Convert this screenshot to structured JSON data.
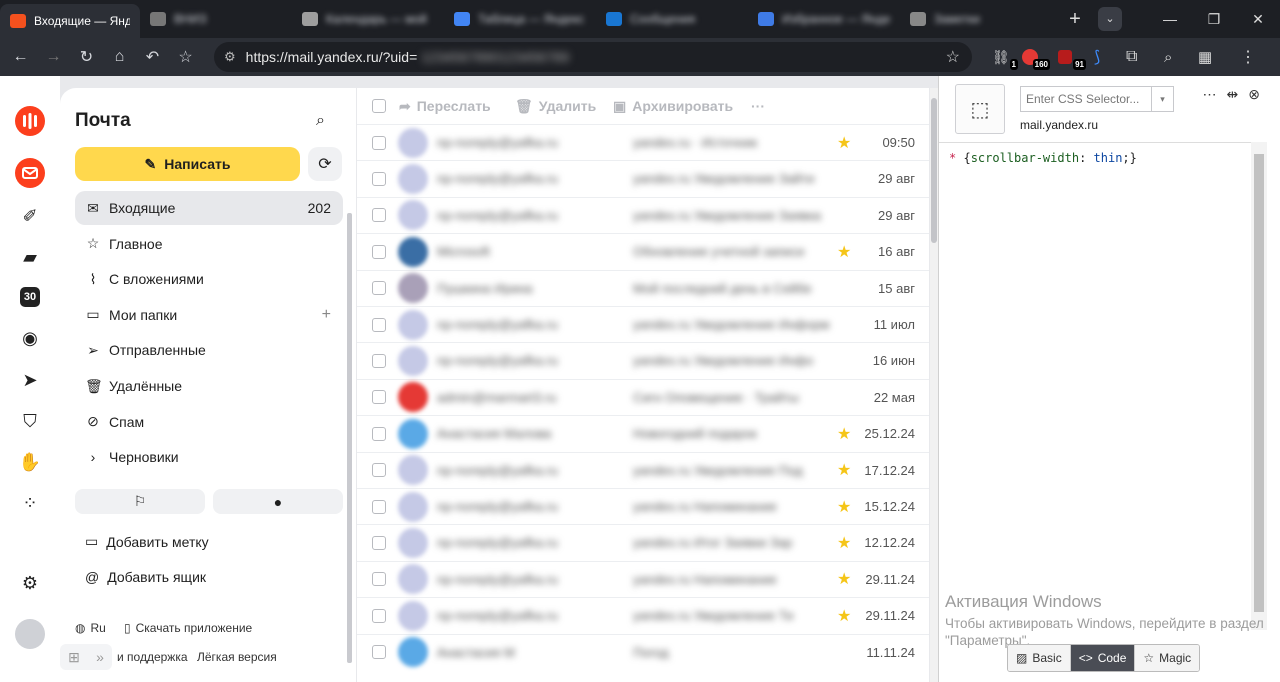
{
  "browser": {
    "tabs": [
      {
        "label": "Входящие — Яндекс",
        "active": true,
        "color": "#f4511e"
      },
      {
        "label": "ВНИЗ",
        "blurred": true,
        "color": "#777777"
      },
      {
        "label": "Календарь — мой",
        "blurred": true,
        "color": "#9e9e9e"
      },
      {
        "label": "Таблица — Яндекс",
        "blurred": true,
        "color": "#4285f4"
      },
      {
        "label": "Сообщения",
        "blurred": true,
        "color": "#1976d2"
      },
      {
        "label": "Избранное — Яндекс",
        "blurred": true,
        "color": "#3f7be6"
      },
      {
        "label": "Заметки",
        "blurred": true,
        "color": "#888888"
      }
    ],
    "new_tab": "+",
    "url": "https://mail.yandex.ru/?uid=",
    "url_hidden": "1234567890123456789",
    "ext_badges": [
      "1",
      "160",
      "91"
    ]
  },
  "mail": {
    "title": "Почта",
    "compose_label": "Написать",
    "folders": [
      {
        "name": "Входящие",
        "count": "202",
        "icon": "envelope-icon"
      },
      {
        "name": "Главное",
        "icon": "star-icon"
      },
      {
        "name": "С вложениями",
        "icon": "paperclip-icon"
      },
      {
        "name": "Мои папки",
        "icon": "folder-icon"
      },
      {
        "name": "Отправленные",
        "icon": "send-icon"
      },
      {
        "name": "Удалённые",
        "icon": "trash-icon"
      },
      {
        "name": "Спам",
        "icon": "ban-icon"
      },
      {
        "name": "Черновики",
        "icon": "chevron-right-icon"
      }
    ],
    "add_label": "Добавить метку",
    "add_mailbox": "Добавить ящик",
    "lang": "Ru",
    "download_app": "Скачать приложение",
    "support": "и поддержка",
    "light_version": "Лёгкая версия"
  },
  "list": {
    "actions": {
      "forward": "Переслать",
      "delete": "Удалить",
      "archive": "Архивировать",
      "more": "···"
    },
    "rows": [
      {
        "sender": "np-noreply@yafka.ru",
        "subject": "yandex.ru  ·  Источник",
        "date": "09:50",
        "starred": true,
        "avatar": "#c5c9e6"
      },
      {
        "sender": "np-noreply@yafka.ru",
        "subject": "yandex.ru Уведомление Зайти",
        "date": "29 авг",
        "starred": false,
        "avatar": "#c5c9e6"
      },
      {
        "sender": "np-noreply@yafka.ru",
        "subject": "yandex.ru Уведомление Заявка",
        "date": "29 авг",
        "starred": false,
        "avatar": "#c5c9e6"
      },
      {
        "sender": "Microsoft",
        "subject": "Обновление учетной записи",
        "date": "16 авг",
        "starred": true,
        "avatar": "#3a6ea5"
      },
      {
        "sender": "Пушкина Ирина",
        "subject": "Мой последний день в Сейбе",
        "date": "15 авг",
        "starred": false,
        "avatar": "#a9a0b8"
      },
      {
        "sender": "np-noreply@yafka.ru",
        "subject": "yandex.ru Уведомление Информ",
        "date": "11 июл",
        "starred": false,
        "avatar": "#c5c9e6"
      },
      {
        "sender": "np-noreply@yafka.ru",
        "subject": "yandex.ru Уведомление Инфо",
        "date": "16 июн",
        "starred": false,
        "avatar": "#c5c9e6"
      },
      {
        "sender": "admin@marmart3.ru",
        "subject": "Сигн Оповещение · Трайты",
        "date": "22 мая",
        "starred": false,
        "avatar": "#e53935"
      },
      {
        "sender": "Анастасия Малова",
        "subject": "Новогодний подарок",
        "date": "25.12.24",
        "starred": true,
        "avatar": "#5aa9e6"
      },
      {
        "sender": "np-noreply@yafka.ru",
        "subject": "yandex.ru Уведомление Под",
        "date": "17.12.24",
        "starred": true,
        "avatar": "#c5c9e6"
      },
      {
        "sender": "np-noreply@yafka.ru",
        "subject": "yandex.ru Напоминание",
        "date": "15.12.24",
        "starred": true,
        "avatar": "#c5c9e6"
      },
      {
        "sender": "np-noreply@yafka.ru",
        "subject": "yandex.ru Итог Заявки Зар",
        "date": "12.12.24",
        "starred": true,
        "avatar": "#c5c9e6"
      },
      {
        "sender": "np-noreply@yafka.ru",
        "subject": "yandex.ru Напоминание",
        "date": "29.11.24",
        "starred": true,
        "avatar": "#c5c9e6"
      },
      {
        "sender": "np-noreply@yafka.ru",
        "subject": "yandex.ru Уведомление Ти",
        "date": "29.11.24",
        "starred": true,
        "avatar": "#c5c9e6"
      },
      {
        "sender": "Анастасия М",
        "subject": "Погод",
        "date": "11.11.24",
        "starred": false,
        "avatar": "#5aa9e6"
      }
    ]
  },
  "devtools": {
    "selector_placeholder": "Enter CSS Selector...",
    "host": "mail.yandex.ru",
    "code_selector": "* ",
    "code_open": "{",
    "code_prop": "scrollbar-width",
    "code_colon": ": ",
    "code_value": "thin",
    "code_close": ";}",
    "modes": [
      "Basic",
      "Code",
      "Magic"
    ],
    "active_mode": "Code",
    "watermark_title": "Активация Windows",
    "watermark_text": "Чтобы активировать Windows, перейдите в раздел \"Параметры\"."
  }
}
